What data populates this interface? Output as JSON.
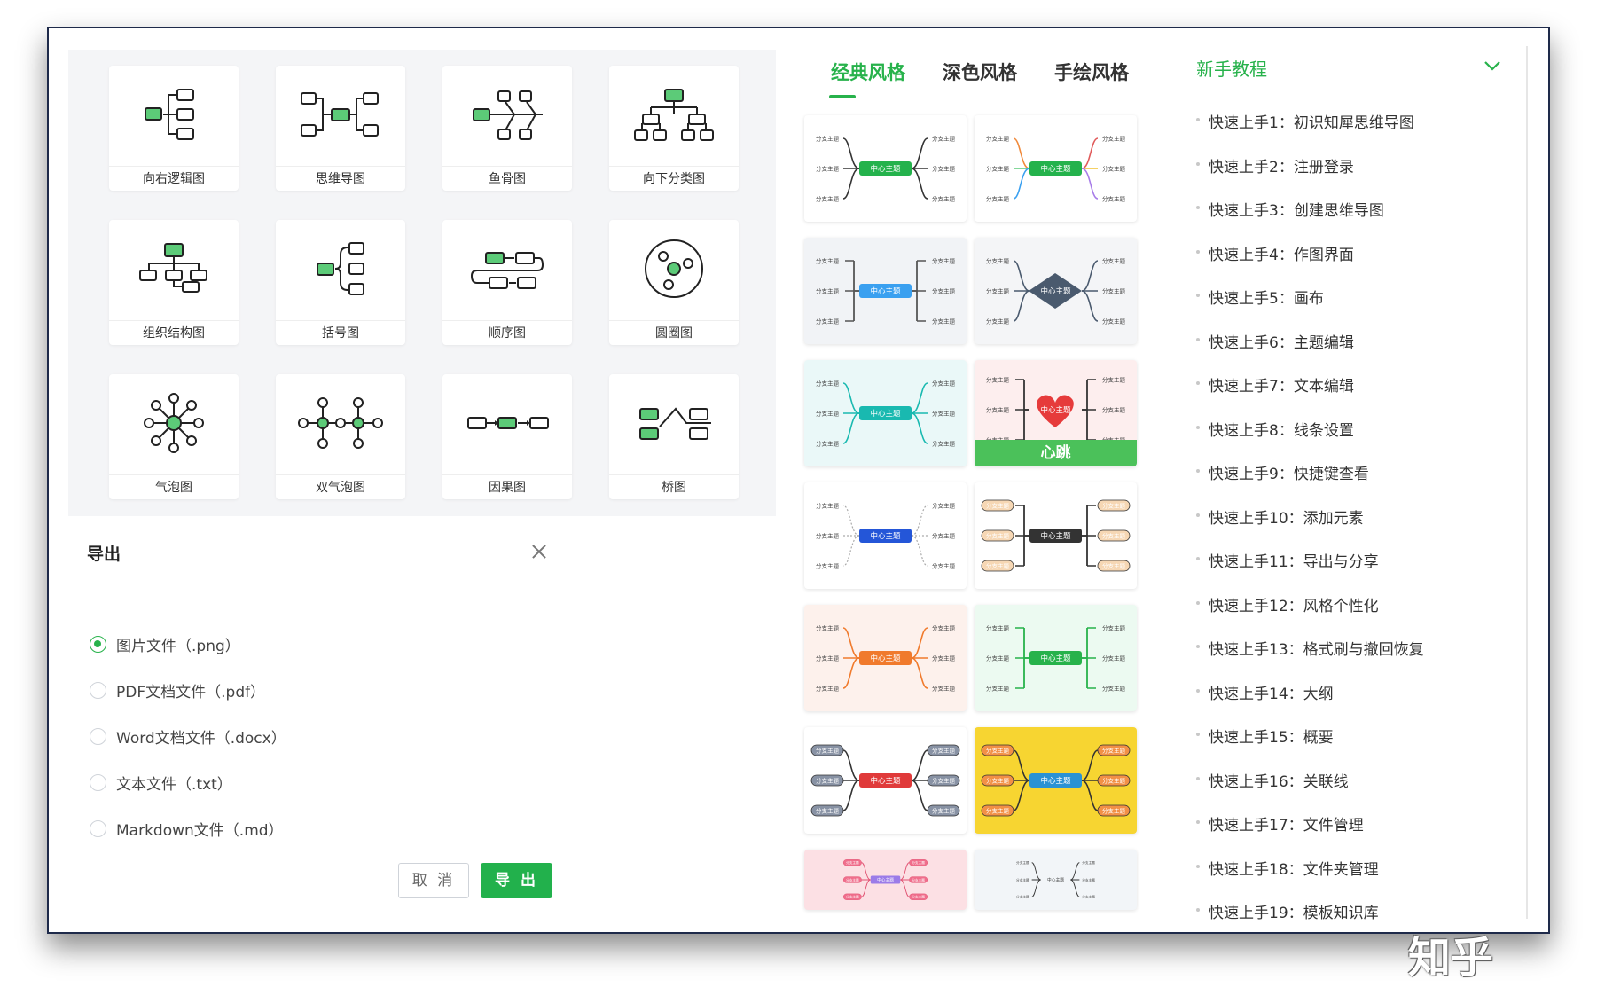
{
  "templates": [
    {
      "label": "向右逻辑图",
      "icon": "right-logic-diagram-icon"
    },
    {
      "label": "思维导图",
      "icon": "mind-map-icon"
    },
    {
      "label": "鱼骨图",
      "icon": "fishbone-diagram-icon"
    },
    {
      "label": "向下分类图",
      "icon": "downward-classification-icon"
    },
    {
      "label": "组织结构图",
      "icon": "org-chart-icon"
    },
    {
      "label": "括号图",
      "icon": "bracket-diagram-icon"
    },
    {
      "label": "顺序图",
      "icon": "sequence-diagram-icon"
    },
    {
      "label": "圆圈图",
      "icon": "circle-map-icon"
    },
    {
      "label": "气泡图",
      "icon": "bubble-map-icon"
    },
    {
      "label": "双气泡图",
      "icon": "double-bubble-map-icon"
    },
    {
      "label": "因果图",
      "icon": "cause-effect-diagram-icon"
    },
    {
      "label": "桥图",
      "icon": "bridge-map-icon"
    }
  ],
  "export_dialog": {
    "title": "导出",
    "options": [
      {
        "label": "图片文件（.png）",
        "selected": true
      },
      {
        "label": "PDF文档文件（.pdf）",
        "selected": false
      },
      {
        "label": "Word文档文件（.docx）",
        "selected": false
      },
      {
        "label": "文本文件（.txt）",
        "selected": false
      },
      {
        "label": "Markdown文件（.md）",
        "selected": false
      }
    ],
    "cancel_label": "取 消",
    "export_label": "导 出"
  },
  "style_tabs": {
    "tabs": [
      "经典风格",
      "深色风格",
      "手绘风格"
    ],
    "active": 0
  },
  "style_thumbs": {
    "center_label": "中心主题",
    "branch_label": "分支主题",
    "heart_caption": "心跳"
  },
  "colors": {
    "accent": "#27b24b",
    "mint_node": "#5ccb78"
  },
  "tutorials": {
    "title": "新手教程",
    "items": [
      "快速上手1：初识知犀思维导图",
      "快速上手2：注册登录",
      "快速上手3：创建思维导图",
      "快速上手4：作图界面",
      "快速上手5：画布",
      "快速上手6：主题编辑",
      "快速上手7：文本编辑",
      "快速上手8：线条设置",
      "快速上手9：快捷键查看",
      "快速上手10：添加元素",
      "快速上手11：导出与分享",
      "快速上手12：风格个性化",
      "快速上手13：格式刷与撤回恢复",
      "快速上手14：大纲",
      "快速上手15：概要",
      "快速上手16：关联线",
      "快速上手17：文件管理",
      "快速上手18：文件夹管理",
      "快速上手19：模板知识库"
    ]
  },
  "watermark": "知乎"
}
